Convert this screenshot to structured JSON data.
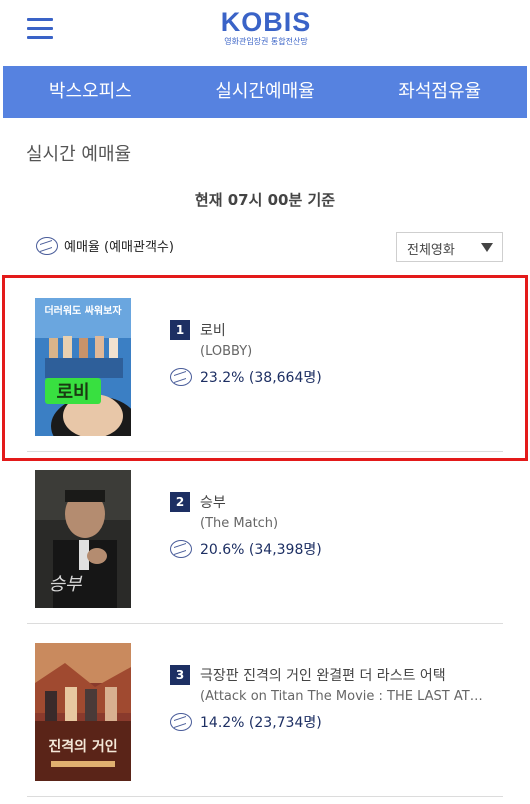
{
  "header": {
    "logo_main": "KOBIS",
    "logo_sub": "영화관입장권 통합전산망",
    "menu_icon": "hamburger-menu-icon"
  },
  "nav": {
    "tabs": [
      {
        "label": "박스오피스"
      },
      {
        "label": "실시간예매율"
      },
      {
        "label": "좌석점유율"
      }
    ]
  },
  "main": {
    "title": "실시간 예매율",
    "time_label": "현재 07시 00분  기준",
    "legend": {
      "icon": "ticket-icon",
      "label": "예매율 (예매관객수)"
    },
    "filter": {
      "selected": "전체영화",
      "icon": "dropdown-arrow-icon"
    }
  },
  "movies": [
    {
      "rank": "1",
      "title_ko": "로비",
      "title_en": "(LOBBY)",
      "rate": "23.2% (38,664명)",
      "poster_text_top": "더러워도 싸워보자",
      "poster_text_main": "로비",
      "poster_bg": "#3b7fc4",
      "poster_accent": "#38e040"
    },
    {
      "rank": "2",
      "title_ko": "승부",
      "title_en": "(The Match)",
      "rate": "20.6% (34,398명)",
      "poster_text_main": "승부",
      "poster_bg": "#2a2a28"
    },
    {
      "rank": "3",
      "title_ko": "극장판 진격의 거인 완결편 더 라스트 어택",
      "title_en": "(Attack on Titan The Movie : THE LAST AT…",
      "rate": "14.2% (23,734명)",
      "poster_text_main": "진격의 거인",
      "poster_bg": "#8a3a2c"
    }
  ],
  "colors": {
    "brand_blue": "#3a63c7",
    "nav_bg": "#5682e0",
    "rank_badge": "#1d2f63",
    "highlight": "#e31a1a"
  }
}
